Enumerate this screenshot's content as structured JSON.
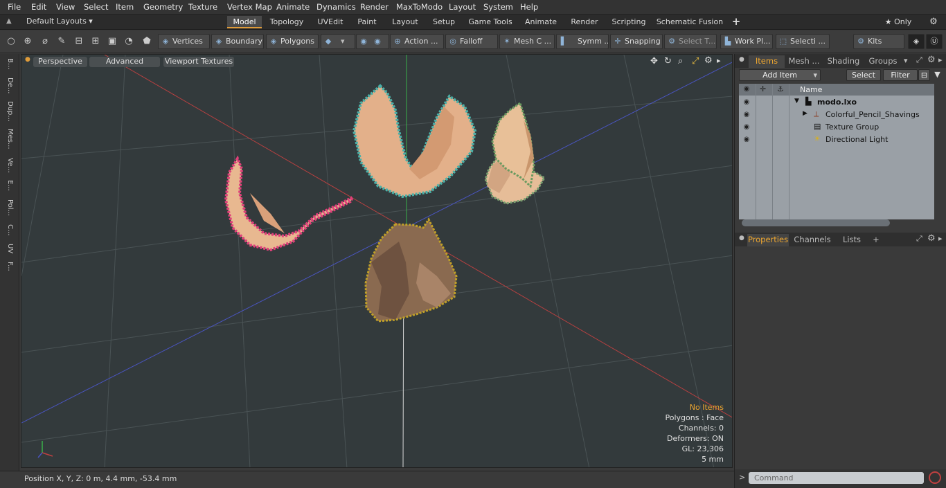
{
  "menu": [
    "File",
    "Edit",
    "View",
    "Select",
    "Item",
    "Geometry",
    "Texture",
    "Vertex Map",
    "Animate",
    "Dynamics",
    "Render",
    "MaxToModo",
    "Layout",
    "System",
    "Help"
  ],
  "layout_dropdown": "Default Layouts ▾",
  "tabs": [
    "Model",
    "Topology",
    "UVEdit",
    "Paint",
    "Layout",
    "Setup",
    "Game Tools",
    "Animate",
    "Render",
    "Scripting",
    "Schematic Fusion"
  ],
  "tab_add": "+",
  "only_label": "★  Only",
  "toolbar": {
    "vertices": "Vertices",
    "boundary": "Boundary",
    "polygons": "Polygons",
    "action": "Action",
    "falloff": "Falloff",
    "mesh": "Mesh C ...",
    "symm": "Symm ...",
    "snapping": "Snapping",
    "select_t": "Select T...",
    "work_pl": "Work Pl...",
    "selecti": "Selecti ...",
    "kits": "Kits"
  },
  "left_tabs": [
    "B...",
    "De...",
    "Dup...",
    "Mes...",
    "Ve...",
    "E...",
    "Pol...",
    "C...",
    "UV",
    "F..."
  ],
  "viewport": {
    "perspective": "Perspective",
    "advanced": "Advanced",
    "textures": "Viewport Textures",
    "stats": [
      "No Items",
      "Polygons : Face",
      "Channels: 0",
      "Deformers: ON",
      "GL: 23,306",
      "5 mm"
    ]
  },
  "status": "Position X, Y, Z:   0 m, 4.4 mm, -53.4 mm",
  "panel_top": {
    "tabs": [
      "Items",
      "Mesh ...",
      "Shading",
      "Groups"
    ],
    "add_item": "Add Item",
    "select": "Select",
    "filter": "Filter",
    "name_header": "Name",
    "items": [
      "modo.lxo",
      "Colorful_Pencil_Shavings",
      "Texture Group",
      "Directional Light"
    ]
  },
  "panel_bottom": {
    "tabs": [
      "Properties",
      "Channels",
      "Lists"
    ],
    "add": "+"
  },
  "command_placeholder": "Command",
  "command_prompt": ">",
  "colors": {
    "accent": "#e09c3a",
    "active_tab_text": "#f0a830",
    "viewport_bg": "#333a3c"
  }
}
